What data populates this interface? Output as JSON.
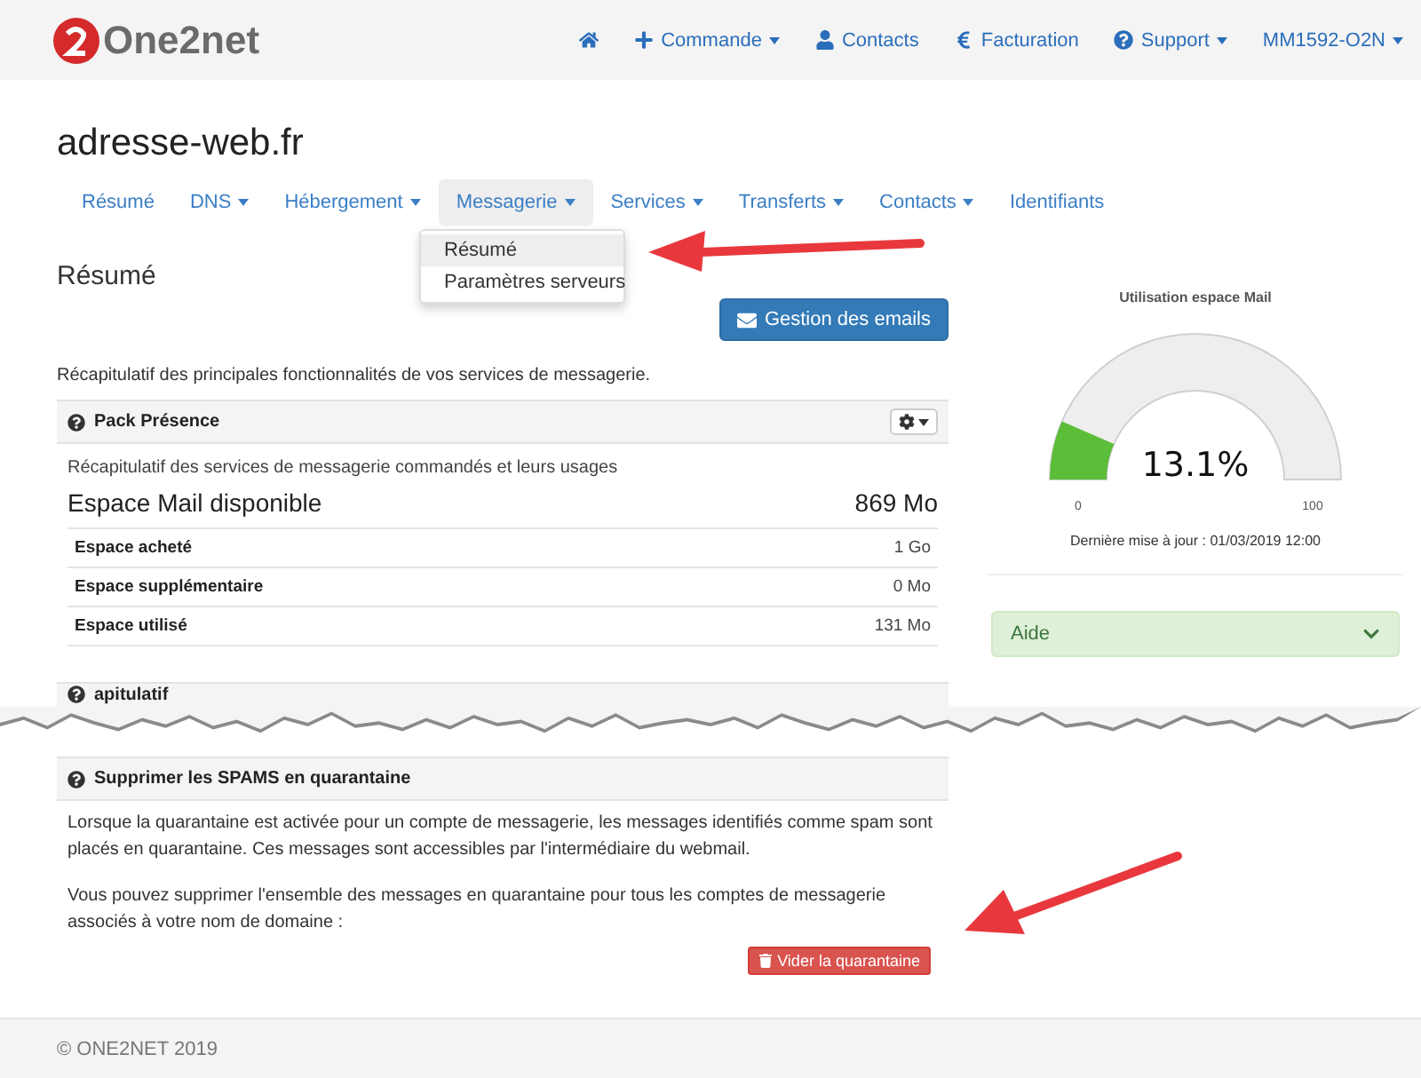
{
  "brand": {
    "name": "One2net"
  },
  "top_nav": [
    {
      "dropdown": false
    },
    {
      "label": "Commande",
      "dropdown": true
    },
    {
      "label": "Contacts",
      "dropdown": false
    },
    {
      "label": "Facturation",
      "dropdown": false
    },
    {
      "label": "Support",
      "dropdown": true
    },
    {
      "label": "MM1592-O2N",
      "dropdown": true
    }
  ],
  "domain": "adresse-web.fr",
  "tabs": [
    {
      "label": "Résumé",
      "dropdown": false,
      "selected": false
    },
    {
      "label": "DNS",
      "dropdown": true,
      "selected": false
    },
    {
      "label": "Hébergement",
      "dropdown": true,
      "selected": false
    },
    {
      "label": "Messagerie",
      "dropdown": true,
      "selected": true
    },
    {
      "label": "Services",
      "dropdown": true,
      "selected": false
    },
    {
      "label": "Transferts",
      "dropdown": true,
      "selected": false
    },
    {
      "label": "Contacts",
      "dropdown": true,
      "selected": false
    },
    {
      "label": "Identifiants",
      "dropdown": false,
      "selected": false
    }
  ],
  "dropdown_menu": [
    {
      "label": "Résumé",
      "selected": true
    },
    {
      "label": "Paramètres serveurs",
      "selected": false
    }
  ],
  "section_title": "Résumé",
  "email_button": "Gestion des emails",
  "intro": "Récapitulatif des principales fonctionnalités de vos services de messagerie.",
  "pack_panel": {
    "title": "Pack Présence",
    "description": "Récapitulatif des services de messagerie commandés et leurs usages",
    "available_label": "Espace Mail disponible",
    "available_value": "869 Mo",
    "rows": [
      {
        "label": "Espace acheté",
        "value": "1 Go"
      },
      {
        "label": "Espace supplémentaire",
        "value": "0 Mo"
      },
      {
        "label": "Espace utilisé",
        "value": "131 Mo"
      }
    ]
  },
  "recap_panel": {
    "title": "apitulatif"
  },
  "gauge": {
    "title": "Utilisation espace Mail",
    "level": 0.131,
    "reading": "13.1%",
    "min": "0",
    "max": "100",
    "updated": "Dernière mise à jour : 01/03/2019 12:00"
  },
  "help": {
    "title": "Aide",
    "expanded": false
  },
  "spam_panel": {
    "title": "Supprimer les SPAMS en quarantaine",
    "paragraphs": [
      "Lorsque la quarantaine est activée pour un compte de messagerie, les messages identifiés comme spam sont placés en quarantaine. Ces messages sont accessibles par l'intermédiaire du webmail.",
      "Vous pouvez supprimer l'ensemble des messages en quarantaine pour tous les comptes de messagerie associés à votre nom de domaine :"
    ],
    "button": "Vider la quarantaine"
  },
  "footer": "© ONE2NET 2019"
}
